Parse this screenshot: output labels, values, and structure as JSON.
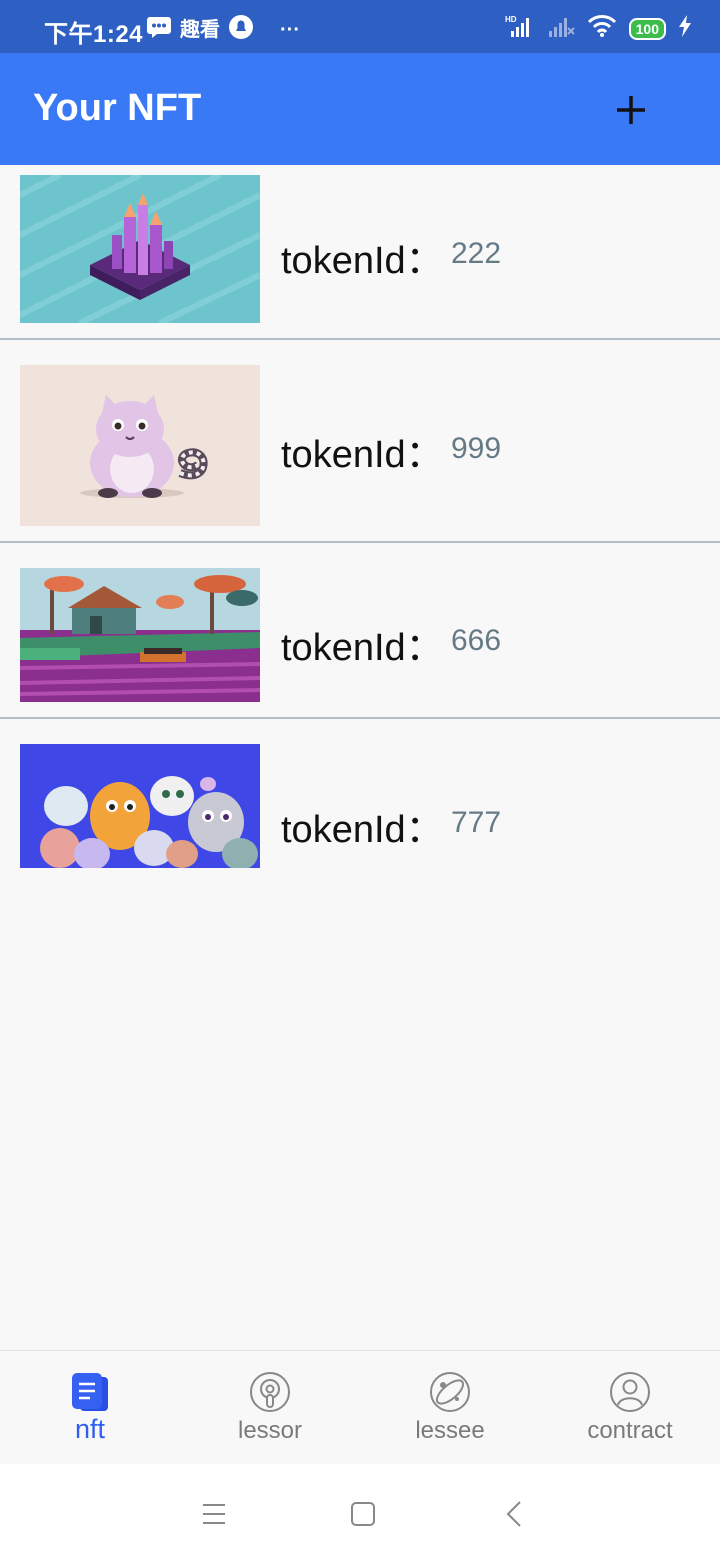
{
  "status_bar": {
    "time": "下午1:24",
    "app_indicator": "趣看",
    "more": "···",
    "battery": "100"
  },
  "app_bar": {
    "title": "Your NFT",
    "add_icon": "plus-icon"
  },
  "nft_list": [
    {
      "label": "tokenId：",
      "token_id": "222",
      "image": "purple-city-artwork"
    },
    {
      "label": "tokenId：",
      "token_id": "999",
      "image": "pink-cryptokitty"
    },
    {
      "label": "tokenId：",
      "token_id": "666",
      "image": "voxel-landscape"
    },
    {
      "label": "tokenId：",
      "token_id": "777",
      "image": "cryptokitties-group"
    }
  ],
  "bottom_nav": [
    {
      "label": "nft",
      "icon": "document-icon",
      "active": true
    },
    {
      "label": "lessor",
      "icon": "podcast-icon",
      "active": false
    },
    {
      "label": "lessee",
      "icon": "planet-icon",
      "active": false
    },
    {
      "label": "contract",
      "icon": "user-icon",
      "active": false
    }
  ],
  "colors": {
    "status_bar": "#2e5fc2",
    "app_bar": "#3a79f6",
    "accent": "#2f5ff0",
    "token_value": "#667a86"
  }
}
